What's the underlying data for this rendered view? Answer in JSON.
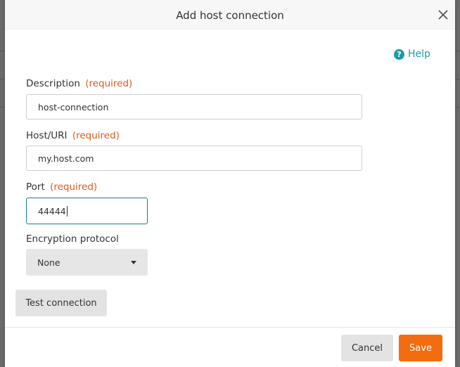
{
  "modal": {
    "title": "Add host connection",
    "help_label": "Help"
  },
  "form": {
    "description": {
      "label": "Description",
      "required": "(required)",
      "value": "host-connection"
    },
    "host": {
      "label": "Host/URI",
      "required": "(required)",
      "value": "my.host.com"
    },
    "port": {
      "label": "Port",
      "required": "(required)",
      "value": "44444"
    },
    "encryption": {
      "label": "Encryption protocol",
      "selected": "None"
    }
  },
  "buttons": {
    "test": "Test connection",
    "cancel": "Cancel",
    "save": "Save"
  },
  "colors": {
    "accent": "#1c9aa6",
    "required": "#e05a1f",
    "primary_button": "#f26c10"
  },
  "icons": {
    "close": "close-icon",
    "help": "question-circle-icon",
    "dropdown": "caret-down-icon"
  }
}
